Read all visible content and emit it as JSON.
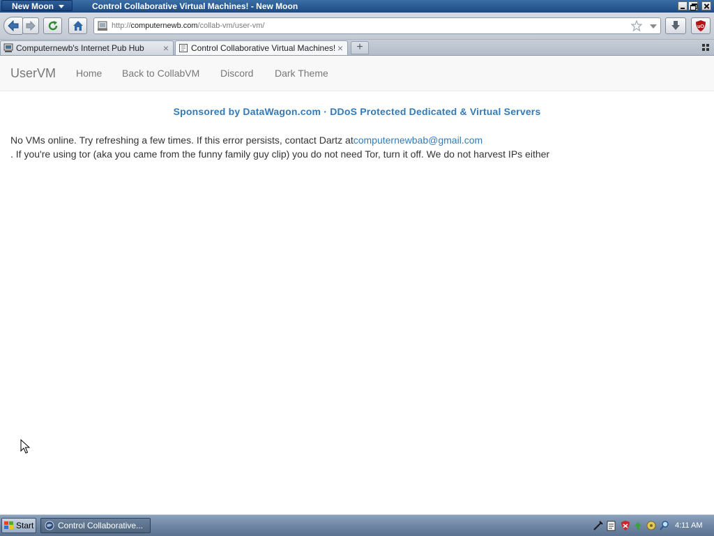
{
  "window": {
    "app_menu_label": "New Moon",
    "title": "Control Collaborative Virtual Machines! - New Moon"
  },
  "address_bar": {
    "scheme": "http://",
    "host": "computernewb.com",
    "path": "/collab-vm/user-vm/"
  },
  "tabs": [
    {
      "label": "Computernewb's Internet Pub Hub",
      "active": false
    },
    {
      "label": "Control Collaborative Virtual Machines!",
      "active": true
    }
  ],
  "site_nav": {
    "brand": "UserVM",
    "links": [
      "Home",
      "Back to CollabVM",
      "Discord",
      "Dark Theme"
    ]
  },
  "sponsor_text": "Sponsored by DataWagon.com · DDoS Protected Dedicated & Virtual Servers",
  "message": {
    "line1": "No VMs online. Try refreshing a few times. If this error persists, contact Dartz at",
    "email": "computernewbab@gmail.com",
    "line2": ". If you're using tor (aka you came from the funny family guy clip) you do not need Tor, turn it off. We do not harvest IPs either"
  },
  "taskbar": {
    "start_label": "Start",
    "task_label": "Control Collaborative...",
    "clock": "4:11 AM"
  },
  "colors": {
    "link": "#337ab7",
    "nav_text": "#777777",
    "titlebar": "#2a5a93"
  }
}
